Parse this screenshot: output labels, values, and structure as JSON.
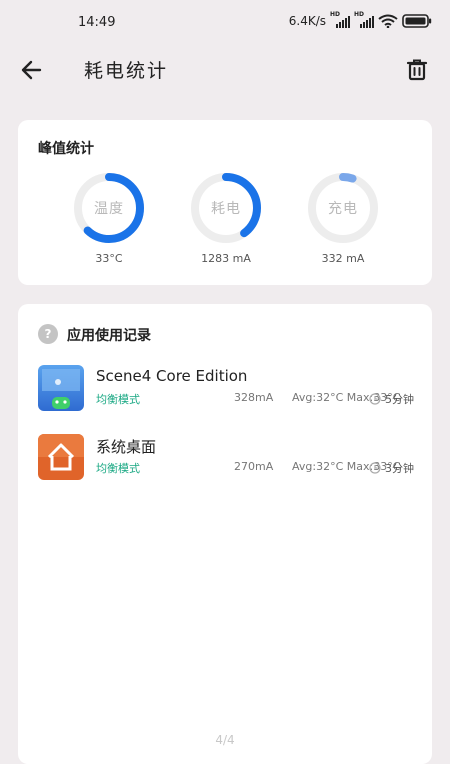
{
  "status_bar": {
    "time": "14:49",
    "net_speed": "6.4K/s",
    "sim1_tag": "HD",
    "sim2_tag": "HD"
  },
  "header": {
    "title": "耗电统计",
    "back_icon": "arrow-left-icon",
    "delete_icon": "trash-icon"
  },
  "peak": {
    "title": "峰值统计",
    "gauges": [
      {
        "label": "温度",
        "value": "33°C",
        "fill": 0.62,
        "color": "#1a73e8"
      },
      {
        "label": "耗电",
        "value": "1283 mA",
        "fill": 0.4,
        "color": "#1a73e8"
      },
      {
        "label": "充电",
        "value": "332 mA",
        "fill": 0.05,
        "color": "#7aa7ea"
      }
    ]
  },
  "usage": {
    "help_mark": "?",
    "title": "应用使用记录",
    "apps": [
      {
        "name": "Scene4 Core Edition",
        "mode": "均衡模式",
        "current": "328mA",
        "avg": "Avg:32°C Max:33°C",
        "time": "5分钟",
        "icon": "scene-app-icon"
      },
      {
        "name": "系统桌面",
        "mode": "均衡模式",
        "current": "270mA",
        "avg": "Avg:32°C Max:33°C",
        "time": "3分钟",
        "icon": "home-launcher-icon"
      }
    ]
  },
  "pager": "4/4"
}
